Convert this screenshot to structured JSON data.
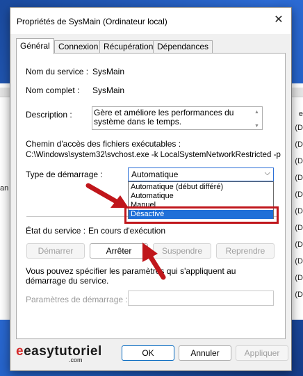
{
  "window": {
    "title": "Propriétés de SysMain (Ordinateur local)"
  },
  "tabs": [
    {
      "label": "Général"
    },
    {
      "label": "Connexion"
    },
    {
      "label": "Récupération"
    },
    {
      "label": "Dépendances"
    }
  ],
  "general": {
    "service_name_label": "Nom du service :",
    "service_name_value": "SysMain",
    "display_name_label": "Nom complet :",
    "display_name_value": "SysMain",
    "description_label": "Description :",
    "description_value": "Gère et améliore les performances du système dans le temps.",
    "path_label": "Chemin d'accès des fichiers exécutables :",
    "path_value": "C:\\Windows\\system32\\svchost.exe -k LocalSystemNetworkRestricted -p",
    "startup_type_label": "Type de démarrage :",
    "startup_type_value": "Automatique",
    "startup_options": [
      "Automatique (début différé)",
      "Automatique",
      "Manuel",
      "Désactivé"
    ],
    "startup_selected": "Désactivé",
    "status_label": "État du service :",
    "status_value": "En cours d'exécution",
    "buttons": {
      "start": "Démarrer",
      "stop": "Arrêter",
      "pause": "Suspendre",
      "resume": "Reprendre"
    },
    "params_note": "Vous pouvez spécifier les paramètres qui s'appliquent au démarrage du service.",
    "params_label": "Paramètres de démarrage :",
    "params_value": ""
  },
  "footer": {
    "ok": "OK",
    "cancel": "Annuler",
    "apply": "Appliquer"
  },
  "watermark": {
    "text": "easytutoriel",
    "suffix": ".com"
  },
  "background": {
    "right_letters": [
      "e",
      "(D",
      "(D",
      "(D",
      "(D",
      "(D",
      "(D",
      "(D",
      "(D",
      "(D",
      "(D",
      "(D",
      "(D",
      "(D"
    ],
    "left_fragment": "an"
  },
  "colors": {
    "accent": "#1f6fd8",
    "annotation_red": "#c0161b"
  }
}
